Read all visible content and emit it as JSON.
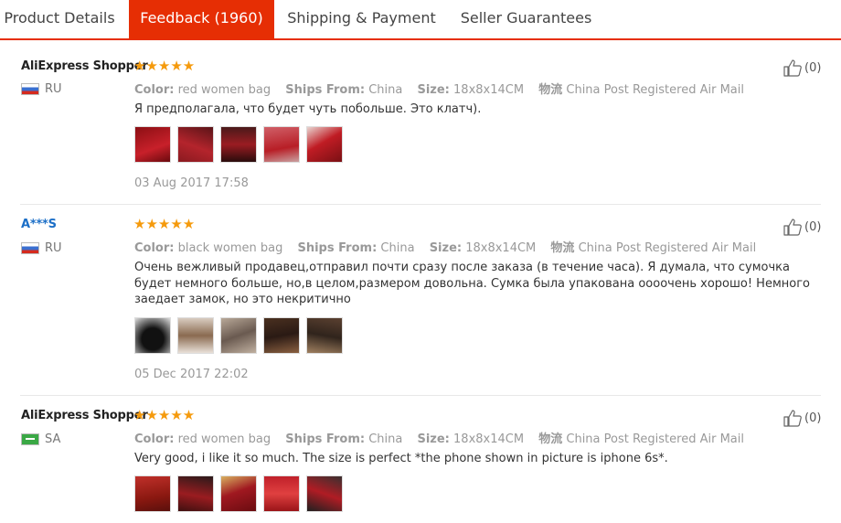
{
  "tabs": [
    {
      "label": "Product Details",
      "active": false
    },
    {
      "label": "Feedback (1960)",
      "active": true
    },
    {
      "label": "Shipping & Payment",
      "active": false
    },
    {
      "label": "Seller Guarantees",
      "active": false
    }
  ],
  "reviews": [
    {
      "user": "AliExpress Shopper",
      "country": "RU",
      "rating": 5,
      "color_label": "Color:",
      "color_value": "red women bag",
      "ships_label": "Ships From:",
      "ships_value": "China",
      "size_label": "Size:",
      "size_value": "18x8x14CM",
      "logistics_label": "物流",
      "logistics_value": "China Post Registered Air Mail",
      "text": "Я предполагала, что будет чуть побольше. Это клатч).",
      "date": "03 Aug 2017 17:58",
      "likes": "(0)"
    },
    {
      "user": "A***S",
      "country": "RU",
      "rating": 5,
      "color_label": "Color:",
      "color_value": "black women bag",
      "ships_label": "Ships From:",
      "ships_value": "China",
      "size_label": "Size:",
      "size_value": "18x8x14CM",
      "logistics_label": "物流",
      "logistics_value": "China Post Registered Air Mail",
      "text": "Очень вежливый продавец,отправил почти сразу после заказа (в течение часа). Я думала, что сумочка будет немного больше, но,в целом,размером довольна. Сумка была упакована оооочень хорошо! Немного заедает замок, но это некритично",
      "date": "05 Dec 2017 22:02",
      "likes": "(0)"
    },
    {
      "user": "AliExpress Shopper",
      "country": "SA",
      "rating": 5,
      "color_label": "Color:",
      "color_value": "red women bag",
      "ships_label": "Ships From:",
      "ships_value": "China",
      "size_label": "Size:",
      "size_value": "18x8x14CM",
      "logistics_label": "物流",
      "logistics_value": "China Post Registered Air Mail",
      "text": "Very good, i like it so much. The size is perfect *the phone shown in picture is iphone 6s*.",
      "likes": "(0)"
    }
  ],
  "stars_glyph": "★★★★★",
  "icons": {
    "like": "thumbs-up-icon",
    "flag_ru": "russia-flag-icon",
    "flag_sa": "saudi-flag-icon"
  },
  "colors": {
    "accent": "#e62e04",
    "star": "#f59a0c",
    "link": "#1c6fc7"
  }
}
